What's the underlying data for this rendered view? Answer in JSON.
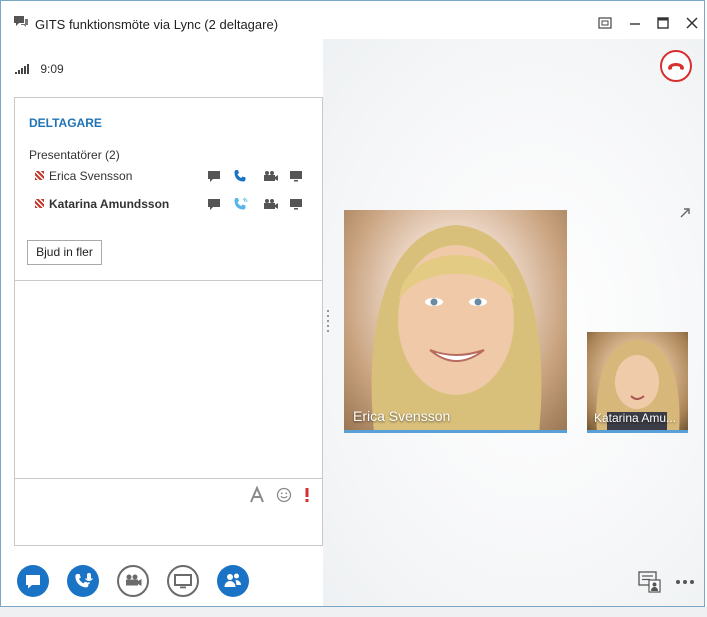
{
  "window": {
    "title": "GITS funktionsmöte via Lync (2 deltagare)",
    "time": "9:09"
  },
  "participants": {
    "section_title": "DELTAGARE",
    "group_label": "Presentatörer (2)",
    "items": [
      {
        "name": "Erica Svensson",
        "bold": false
      },
      {
        "name": "Katarina Amundsson",
        "bold": true
      }
    ],
    "invite_label": "Bjud in fler"
  },
  "video": {
    "main_name": "Erica Svensson",
    "side_name": "Katarina Amu..."
  },
  "colors": {
    "accent": "#1a73c4",
    "title_blue": "#1f73b7",
    "hangup_red": "#d63030",
    "presenter_flag": "#c0392b"
  },
  "icons": [
    "conversation-icon",
    "minimize-icon",
    "maximize-icon",
    "restore-icon",
    "close-icon",
    "signal-icon",
    "hangup-icon",
    "im-icon",
    "phone-icon",
    "video-icon",
    "screen-icon",
    "font-icon",
    "emoticon-icon",
    "important-icon",
    "popout-icon",
    "participants-icon",
    "more-icon"
  ]
}
